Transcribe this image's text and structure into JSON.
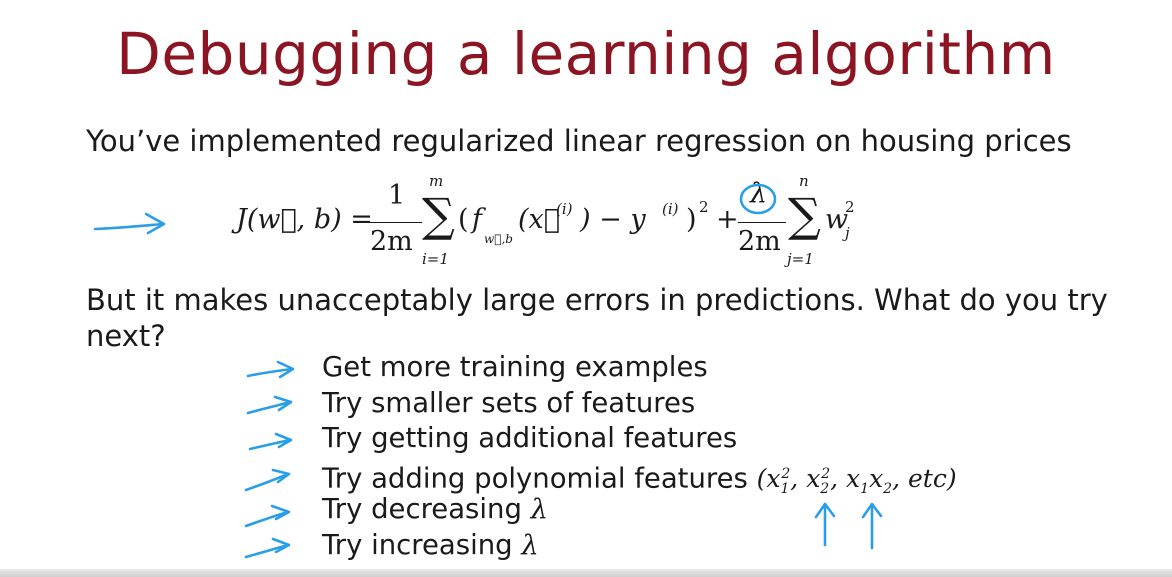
{
  "slide": {
    "title": "Debugging a learning algorithm",
    "intro": "You’ve implemented regularized linear regression on housing prices",
    "question": "But it makes unacceptably large errors in predictions. What do you try next?",
    "formula": {
      "lhs": "J(w⃗, b) =",
      "frac1_num": "1",
      "frac1_den": "2m",
      "sum1_upper": "m",
      "sum1_lower": "i=1",
      "open_paren": "(",
      "f": "f",
      "f_sub": "w⃗,b",
      "x_arg": "(x⃗",
      "x_sup": "(i)",
      "minus_y": ") − y",
      "y_sup": "(i)",
      "close_paren": ")",
      "power2": "2",
      "plus": "+",
      "lambda": "λ",
      "frac2_den": "2m",
      "sum2_upper": "n",
      "sum2_lower": "j=1",
      "w": "w",
      "w_sub": "j",
      "w_sup": "2"
    },
    "options": [
      "Get more training examples",
      "Try smaller sets of features",
      "Try getting additional features",
      "Try adding polynomial features",
      "Try decreasing",
      "Try increasing"
    ],
    "lambda_symbol": "λ",
    "poly": {
      "open": "(x",
      "x1_sub": "1",
      "x1_sup": "2",
      "comma1": ", x",
      "x2_sub": "2",
      "x2_sup": "2",
      "comma2": ", x",
      "x1b_sub": "1",
      "x": "x",
      "x2b_sub": "2",
      "tail": ", etc)"
    }
  },
  "annotations": {
    "ink_color": "#2a9ee6"
  }
}
